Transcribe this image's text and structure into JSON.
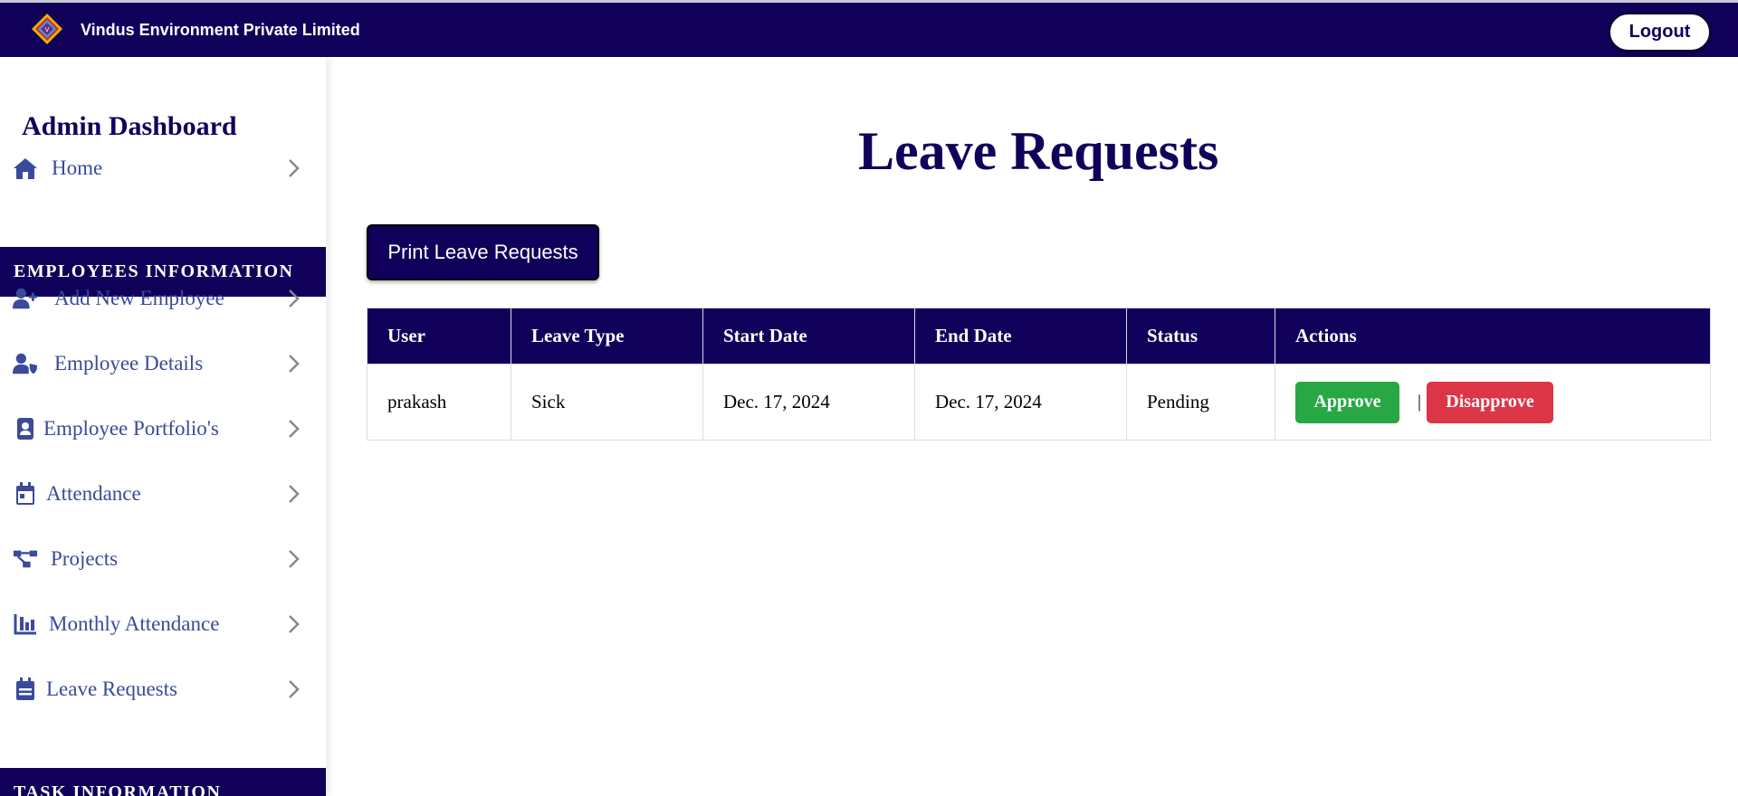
{
  "header": {
    "brand": "Vindus Environment Private Limited",
    "logout_label": "Logout",
    "logo_icon": "vindus-diamond-logo"
  },
  "sidebar": {
    "title": "Admin Dashboard",
    "home": {
      "label": "Home",
      "icon": "home-icon"
    },
    "section_employees": "EMPLOYEES INFORMATION",
    "items": [
      {
        "label": "Add New Employee",
        "icon": "user-plus-icon"
      },
      {
        "label": "Employee Details",
        "icon": "user-shield-icon"
      },
      {
        "label": "Employee Portfolio's",
        "icon": "portrait-icon"
      },
      {
        "label": "Attendance",
        "icon": "calendar-icon"
      },
      {
        "label": "Projects",
        "icon": "project-diagram-icon"
      },
      {
        "label": "Monthly Attendance",
        "icon": "bar-chart-icon"
      },
      {
        "label": "Leave Requests",
        "icon": "calendar-list-icon"
      }
    ],
    "section_tasks": "TASK INFORMATION"
  },
  "main": {
    "title": "Leave Requests",
    "print_label": "Print Leave Requests",
    "table": {
      "headers": [
        "User",
        "Leave Type",
        "Start Date",
        "End Date",
        "Status",
        "Actions"
      ],
      "rows": [
        {
          "user": "prakash",
          "leave_type": "Sick",
          "start_date": "Dec. 17, 2024",
          "end_date": "Dec. 17, 2024",
          "status": "Pending"
        }
      ],
      "approve_label": "Approve",
      "separator": "|",
      "disapprove_label": "Disapprove"
    }
  },
  "colors": {
    "primary": "#10005a",
    "sidebar_text": "#3b4a9a",
    "approve": "#28a745",
    "disapprove": "#dc3545"
  }
}
